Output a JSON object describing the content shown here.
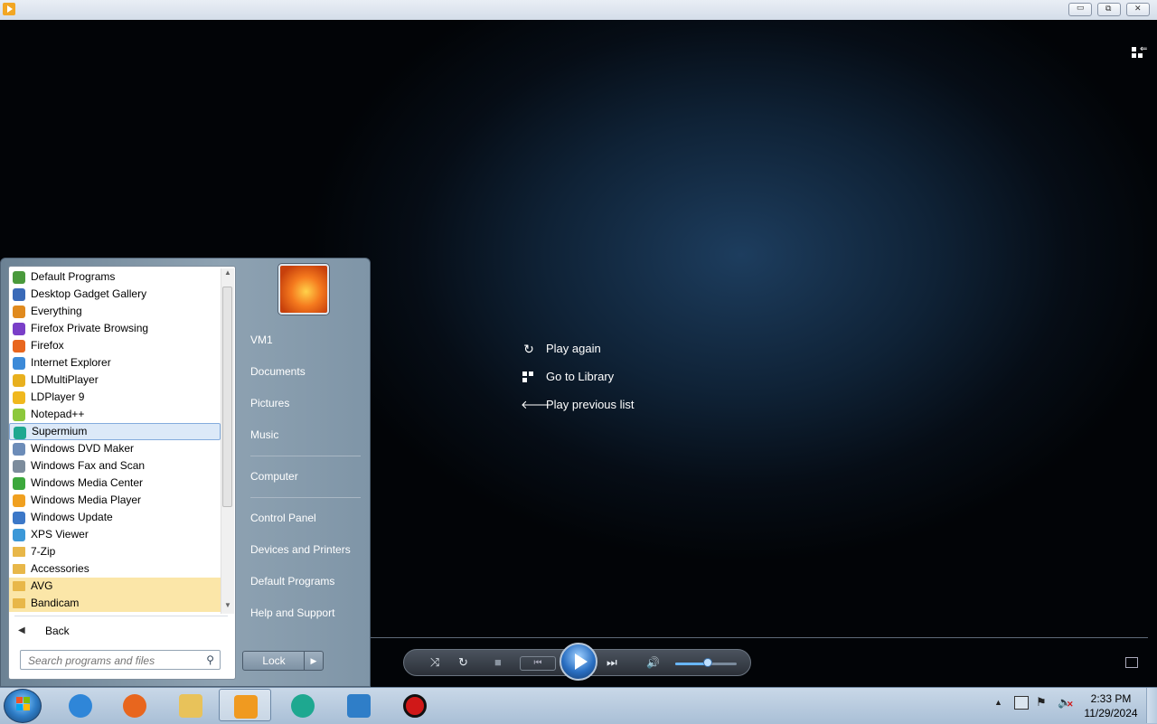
{
  "titlebar": {
    "minimize": "▭",
    "restore": "⧉",
    "close": "✕"
  },
  "player": {
    "end_menu": [
      {
        "label": "Play again",
        "icon": "replay-icon"
      },
      {
        "label": "Go to Library",
        "icon": "library-icon"
      },
      {
        "label": "Play previous list",
        "icon": "back-arrow-icon"
      }
    ],
    "controls": {
      "shuffle": "⤨",
      "repeat": "↻",
      "stop": "■",
      "previous": "⏮",
      "next": "⏭",
      "volume": "🔊",
      "volume_level": 0.5
    }
  },
  "start_menu": {
    "programs": [
      {
        "label": "Default Programs",
        "icon_color": "#4a9a3c"
      },
      {
        "label": "Desktop Gadget Gallery",
        "icon_color": "#3a6ab8"
      },
      {
        "label": "Everything",
        "icon_color": "#e08a1e"
      },
      {
        "label": "Firefox Private Browsing",
        "icon_color": "#7a3fc8"
      },
      {
        "label": "Firefox",
        "icon_color": "#e8661e"
      },
      {
        "label": "Internet Explorer",
        "icon_color": "#3c8ad8"
      },
      {
        "label": "LDMultiPlayer",
        "icon_color": "#e8b01e"
      },
      {
        "label": "LDPlayer 9",
        "icon_color": "#f0b81e"
      },
      {
        "label": "Notepad++",
        "icon_color": "#8cc83c"
      },
      {
        "label": "Supermium",
        "icon_color": "#1ea890",
        "selected": true
      },
      {
        "label": "Windows DVD Maker",
        "icon_color": "#6c8cb8"
      },
      {
        "label": "Windows Fax and Scan",
        "icon_color": "#7c8c9c"
      },
      {
        "label": "Windows Media Center",
        "icon_color": "#3ca83c"
      },
      {
        "label": "Windows Media Player",
        "icon_color": "#f0a020"
      },
      {
        "label": "Windows Update",
        "icon_color": "#3c78c8"
      },
      {
        "label": "XPS Viewer",
        "icon_color": "#3c98d8"
      },
      {
        "label": "7-Zip",
        "folder": true
      },
      {
        "label": "Accessories",
        "folder": true
      },
      {
        "label": "AVG",
        "folder": true,
        "highlight": true
      },
      {
        "label": "Bandicam",
        "folder": true,
        "highlight": true
      }
    ],
    "back_label": "Back",
    "search_placeholder": "Search programs and files",
    "right_links": [
      {
        "label": "VM1"
      },
      {
        "label": "Documents"
      },
      {
        "label": "Pictures"
      },
      {
        "label": "Music",
        "sep_after": true
      },
      {
        "label": "Computer",
        "sep_after": true
      },
      {
        "label": "Control Panel"
      },
      {
        "label": "Devices and Printers"
      },
      {
        "label": "Default Programs"
      },
      {
        "label": "Help and Support"
      }
    ],
    "lock_label": "Lock"
  },
  "taskbar": {
    "apps": [
      {
        "name": "internet-explorer",
        "color": "#2f86d8"
      },
      {
        "name": "firefox",
        "color": "#e8661e"
      },
      {
        "name": "file-explorer",
        "color": "#e8c25a"
      },
      {
        "name": "windows-media-player",
        "color": "#f09a20",
        "active": true
      },
      {
        "name": "supermium",
        "color": "#1ea890"
      },
      {
        "name": "video-app",
        "color": "#2f7ec8"
      },
      {
        "name": "bandicam",
        "color": "#d01818"
      }
    ],
    "clock_time": "2:33 PM",
    "clock_date": "11/29/2024"
  }
}
